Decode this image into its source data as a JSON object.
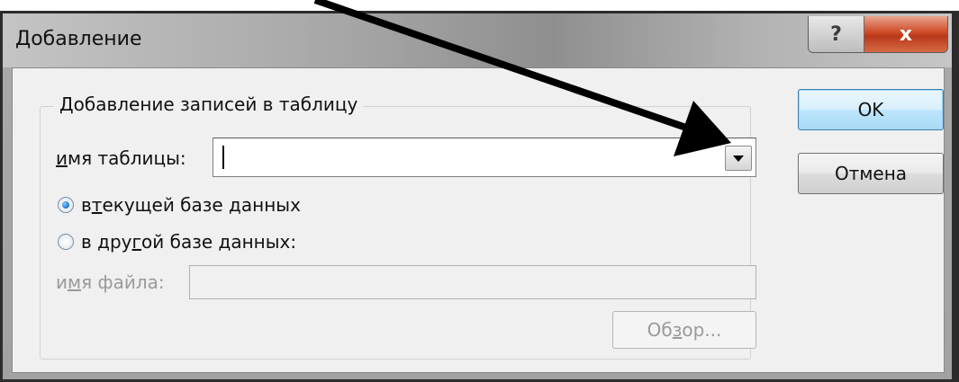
{
  "dialog": {
    "title": "Добавление",
    "help_button": "?",
    "close_button": "x"
  },
  "group": {
    "title": "Добавление записей в таблицу",
    "table_name_label": {
      "u": "и",
      "rest": "мя таблицы:"
    },
    "table_name_value": "",
    "radio_current": {
      "pre": "в ",
      "u": "т",
      "rest": "екущей базе данных",
      "checked": true
    },
    "radio_other": {
      "pre": "в дру",
      "u": "г",
      "rest": "ой базе данных:",
      "checked": false
    },
    "file_name_label": {
      "pre": "и",
      "u": "м",
      "rest": "я файла:"
    },
    "file_name_value": "",
    "browse_button": {
      "pre": "Об",
      "u": "з",
      "rest": "ор..."
    }
  },
  "buttons": {
    "ok": "OK",
    "cancel": "Отмена"
  },
  "colors": {
    "arrow": "#000000",
    "close_button": "#c9462a",
    "default_button_border": "#3c7fb1"
  }
}
